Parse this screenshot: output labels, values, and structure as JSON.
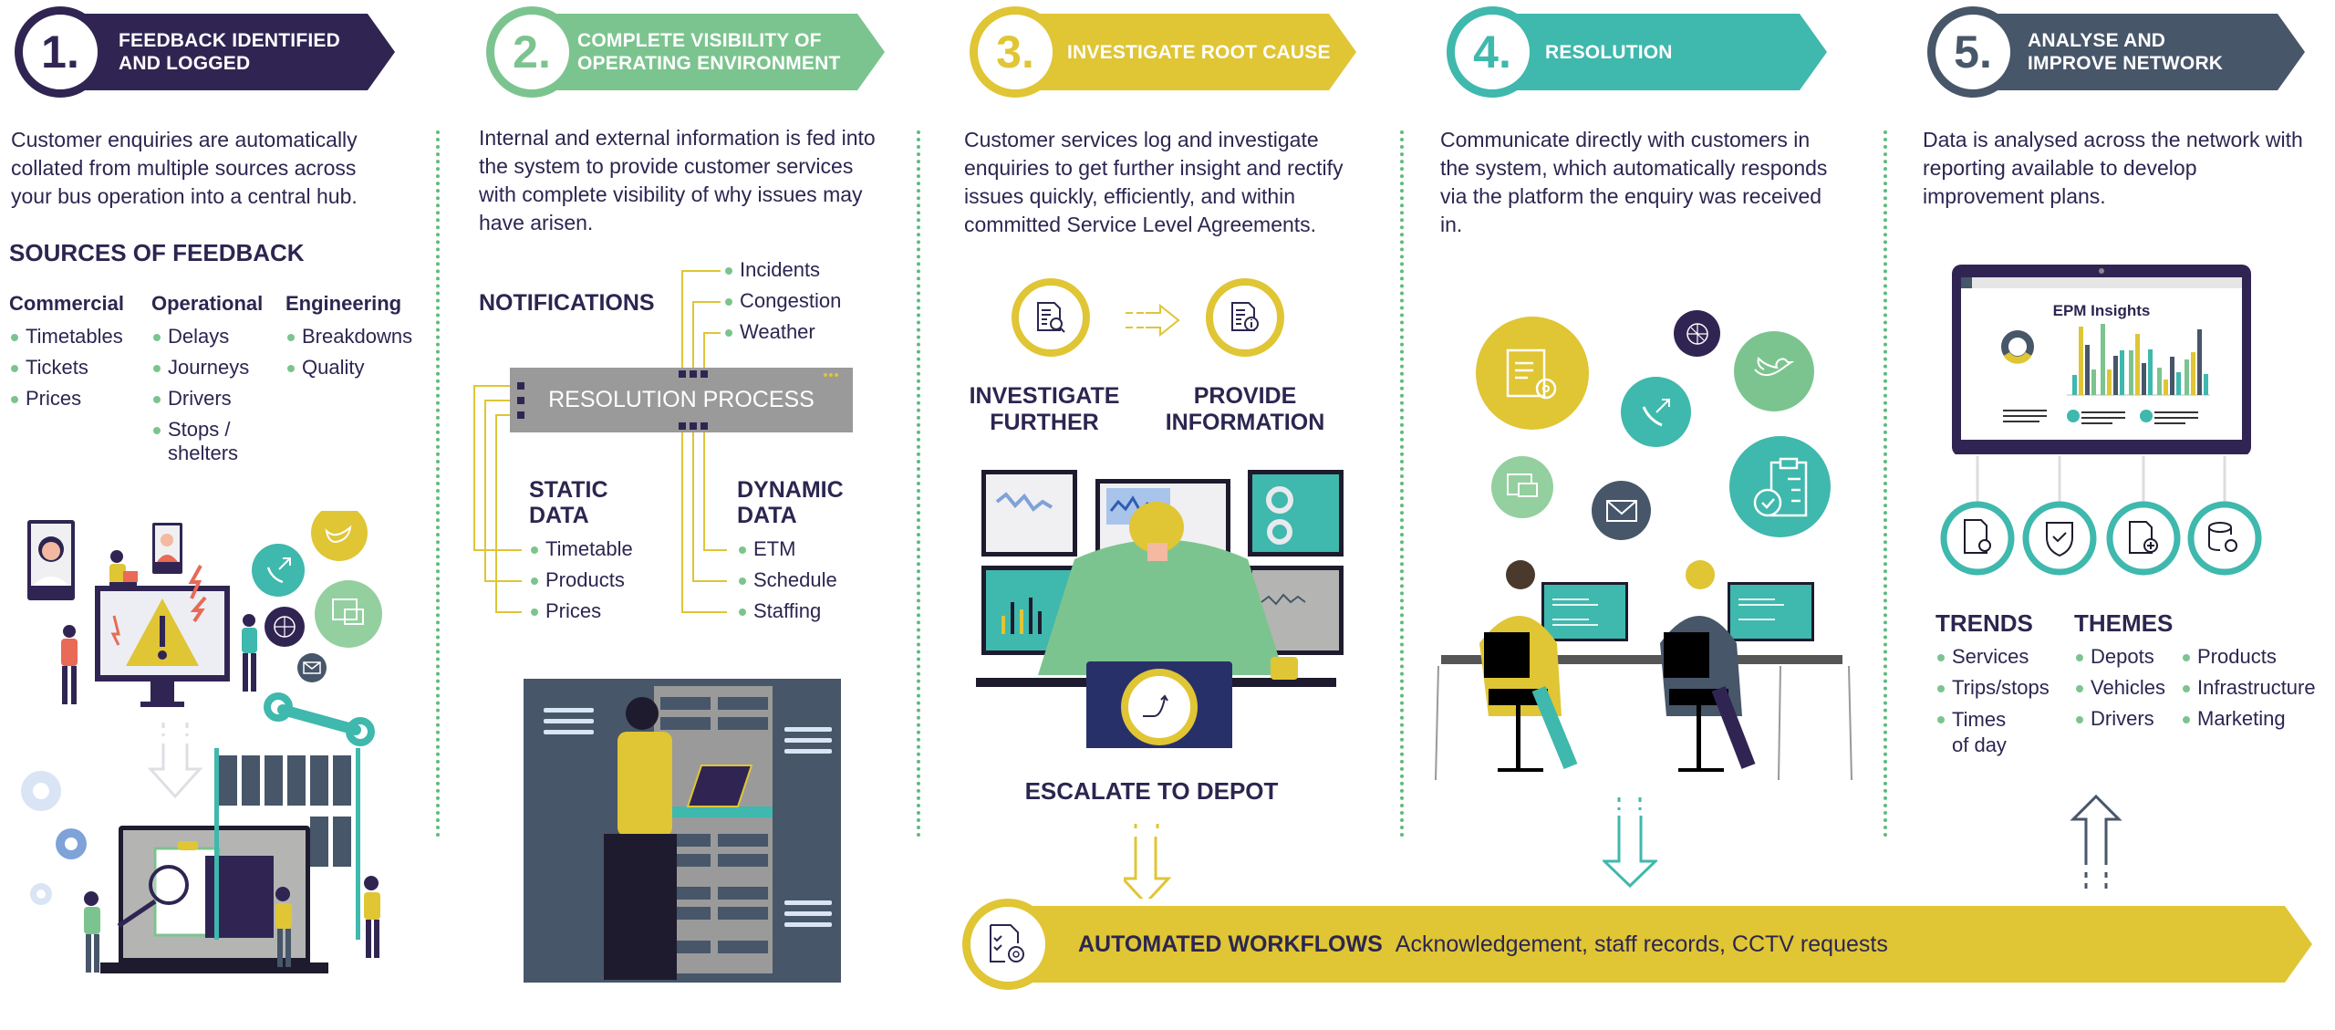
{
  "colors": {
    "step1": "#302552",
    "step2": "#7cc48f",
    "step3": "#e0c535",
    "step4": "#3fb8ad",
    "step5": "#475669",
    "text": "#2b2650",
    "divider": "#5dbb7c"
  },
  "steps": [
    {
      "number": "1.",
      "title": "FEEDBACK IDENTIFIED\nAND LOGGED",
      "description": "Customer enquiries are automatically collated from multiple sources across your bus operation into a central hub."
    },
    {
      "number": "2.",
      "title": "COMPLETE VISIBILITY OF\nOPERATING ENVIRONMENT",
      "description": "Internal and external information is fed into the system to provide customer services with complete visibility of why issues may have arisen."
    },
    {
      "number": "3.",
      "title": "INVESTIGATE ROOT CAUSE",
      "description": "Customer services log and investigate enquiries to get further insight and rectify issues quickly, efficiently, and within committed Service Level Agreements."
    },
    {
      "number": "4.",
      "title": "RESOLUTION",
      "description": "Communicate directly with customers in the system, which automatically responds via the platform the enquiry was received in."
    },
    {
      "number": "5.",
      "title": "ANALYSE AND\nIMPROVE NETWORK",
      "description": "Data is analysed across the network with reporting available to develop improvement plans."
    }
  ],
  "sources": {
    "heading": "SOURCES OF FEEDBACK",
    "columns": [
      {
        "title": "Commercial",
        "items": [
          "Timetables",
          "Tickets",
          "Prices"
        ]
      },
      {
        "title": "Operational",
        "items": [
          "Delays",
          "Journeys",
          "Drivers",
          "Stops / shelters"
        ]
      },
      {
        "title": "Engineering",
        "items": [
          "Breakdowns",
          "Quality"
        ]
      }
    ]
  },
  "visibility": {
    "notifications_heading": "NOTIFICATIONS",
    "notifications": [
      "Incidents",
      "Congestion",
      "Weather"
    ],
    "process_label": "RESOLUTION PROCESS",
    "static_heading": "STATIC\nDATA",
    "static_items": [
      "Timetable",
      "Products",
      "Prices"
    ],
    "dynamic_heading": "DYNAMIC\nDATA",
    "dynamic_items": [
      "ETM",
      "Schedule",
      "Staffing"
    ]
  },
  "investigate": {
    "left_label": "INVESTIGATE\nFURTHER",
    "right_label": "PROVIDE\nINFORMATION",
    "escalate_label": "ESCALATE TO DEPOT"
  },
  "analyse": {
    "dashboard_title": "EPM Insights",
    "trends_heading": "TRENDS",
    "trends": [
      "Services",
      "Trips/stops",
      "Times of day"
    ],
    "themes_heading": "THEMES",
    "themes_col1": [
      "Depots",
      "Vehicles",
      "Drivers"
    ],
    "themes_col2": [
      "Products",
      "Infrastructure",
      "Marketing"
    ]
  },
  "workflows": {
    "title": "AUTOMATED WORKFLOWS",
    "text": "Acknowledgement, staff records, CCTV requests"
  }
}
